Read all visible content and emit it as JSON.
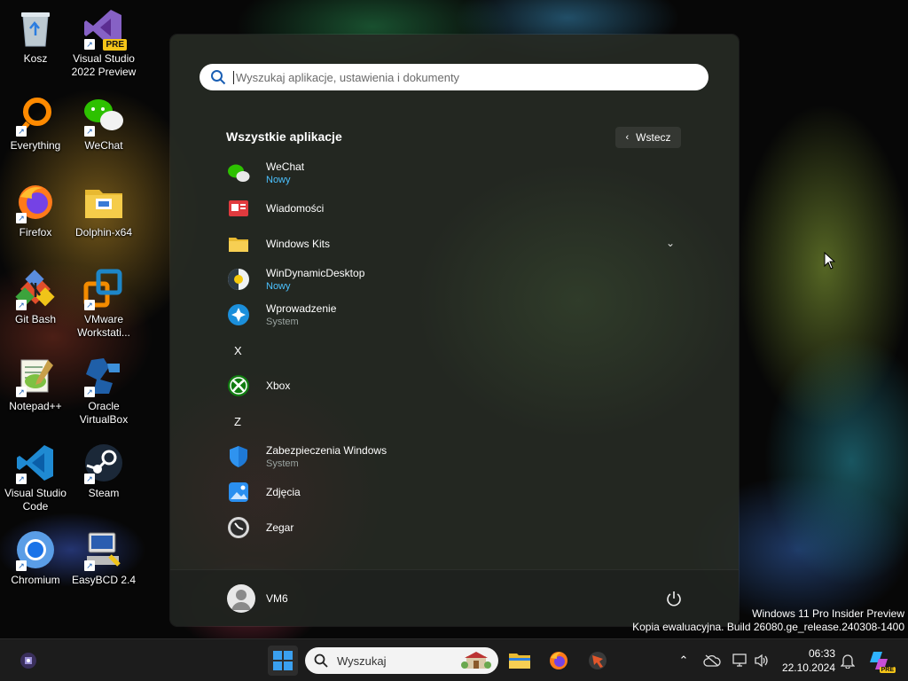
{
  "desktop": {
    "icons": [
      {
        "label": "Kosz"
      },
      {
        "label": "Visual Studio\n2022 Preview"
      },
      {
        "label": "Everything"
      },
      {
        "label": "WeChat"
      },
      {
        "label": "Firefox"
      },
      {
        "label": "Dolphin-x64"
      },
      {
        "label": "Git Bash"
      },
      {
        "label": "VMware\nWorkstati..."
      },
      {
        "label": "Notepad++"
      },
      {
        "label": "Oracle\nVirtualBox"
      },
      {
        "label": "Visual Studio\nCode"
      },
      {
        "label": "Steam"
      },
      {
        "label": "Chromium"
      },
      {
        "label": "EasyBCD 2.4"
      }
    ],
    "vs_badge": "PRE"
  },
  "start_menu": {
    "search_placeholder": "Wyszukaj aplikacje, ustawienia i dokumenty",
    "section_title": "Wszystkie aplikacje",
    "back_label": "Wstecz",
    "apps": [
      {
        "name": "WeChat",
        "sub": "Nowy"
      },
      {
        "name": "Wiadomości",
        "sub": ""
      },
      {
        "name": "Windows Kits",
        "sub": ""
      },
      {
        "name": "WinDynamicDesktop",
        "sub": "Nowy"
      },
      {
        "name": "Wprowadzenie",
        "sub": "System"
      },
      {
        "letter": "X"
      },
      {
        "name": "Xbox",
        "sub": ""
      },
      {
        "letter": "Z"
      },
      {
        "name": "Zabezpieczenia Windows",
        "sub": "System"
      },
      {
        "name": "Zdjęcia",
        "sub": ""
      },
      {
        "name": "Zegar",
        "sub": ""
      }
    ],
    "user_name": "VM6"
  },
  "watermark": {
    "line1": "Windows 11 Pro Insider Preview",
    "line2": "Kopia ewaluacyjna. Build 26080.ge_release.240308-1400"
  },
  "taskbar": {
    "search_label": "Wyszukaj",
    "time": "06:33",
    "date": "22.10.2024",
    "copilot_badge": "PRE"
  },
  "colors": {
    "accent": "#4cc2ff",
    "taskbar": "#1c1c1c"
  }
}
